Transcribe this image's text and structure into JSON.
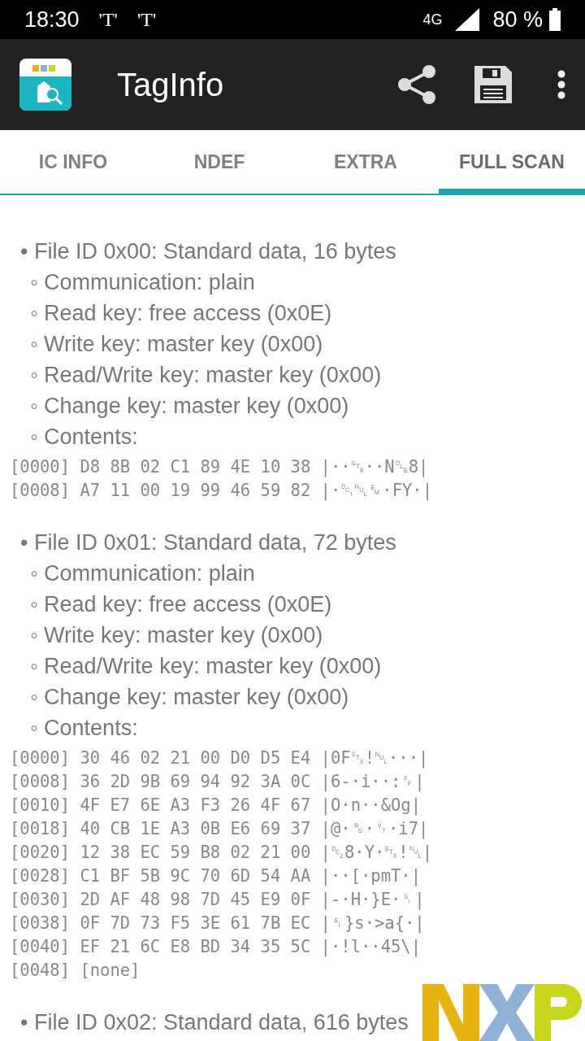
{
  "status_bar": {
    "time": "18:30",
    "notification_icons": [
      "'T'",
      "'T'"
    ],
    "network": "4G",
    "battery": "80 %"
  },
  "app_bar": {
    "title": "TagInfo"
  },
  "tabs": [
    {
      "label": "IC INFO",
      "selected": false
    },
    {
      "label": "NDEF",
      "selected": false
    },
    {
      "label": "EXTRA",
      "selected": false
    },
    {
      "label": "FULL SCAN",
      "selected": true
    }
  ],
  "files": [
    {
      "title": "• File ID 0x00: Standard data, 16 bytes",
      "properties": [
        "◦ Communication: plain",
        "◦ Read key: free access (0x0E)",
        "◦ Write key: master key (0x00)",
        "◦ Read/Write key: master key (0x00)",
        "◦ Change key: master key (0x00)",
        "◦ Contents:"
      ],
      "hex_lines": [
        "[0000] D8 8B 02 C1 89 4E 10 38 |··␂··N␐8|",
        "[0008] A7 11 00 19 99 46 59 82 |·␑␀␙·FY·|"
      ]
    },
    {
      "title": "• File ID 0x01: Standard data, 72 bytes",
      "properties": [
        "◦ Communication: plain",
        "◦ Read key: free access (0x0E)",
        "◦ Write key: master key (0x00)",
        "◦ Read/Write key: master key (0x00)",
        "◦ Change key: master key (0x00)",
        "◦ Contents:"
      ],
      "hex_lines": [
        "[0000] 30 46 02 21 00 D0 D5 E4 |0F␂!␀···|",
        "[0008] 36 2D 9B 69 94 92 3A 0C |6-·i··:␌|",
        "[0010] 4F E7 6E A3 F3 26 4F 67 |O·n··&Og|",
        "[0018] 40 CB 1E A3 0B E6 69 37 |@·␞·␋·i7|",
        "[0020] 12 38 EC 59 B8 02 21 00 |␒8·Y·␂!␀|",
        "[0028] C1 BF 5B 9C 70 6D 54 AA |··[·pmT·|",
        "[0030] 2D AF 48 98 7D 45 E9 0F |-·H·}E·␏|",
        "[0038] 0F 7D 73 F5 3E 61 7B EC |␏}s·>a{·|",
        "[0040] EF 21 6C E8 BD 34 35 5C |·!l··45\\|",
        "[0048] [none]"
      ]
    },
    {
      "title": "• File ID 0x02: Standard data, 616 bytes"
    }
  ]
}
